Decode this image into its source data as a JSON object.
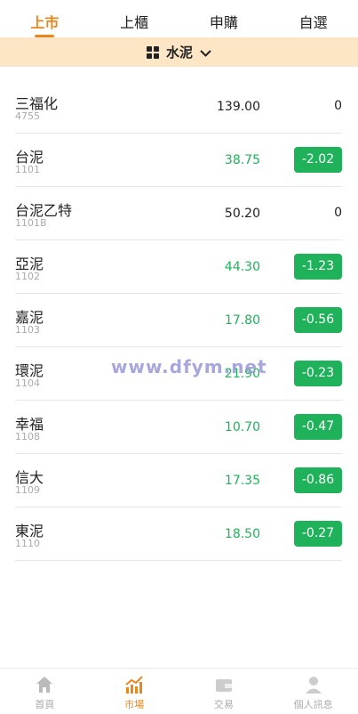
{
  "tabs": [
    {
      "label": "上市",
      "active": true
    },
    {
      "label": "上櫃",
      "active": false
    },
    {
      "label": "申購",
      "active": false
    },
    {
      "label": "自選",
      "active": false
    }
  ],
  "sector": {
    "label": "水泥",
    "icon": "grid-icon",
    "dropdown_icon": "chevron-down-icon"
  },
  "stocks": [
    {
      "name": "三福化",
      "code": "4755",
      "price": "139.00",
      "change": "0"
    },
    {
      "name": "台泥",
      "code": "1101",
      "price": "38.75",
      "change": "-2.02"
    },
    {
      "name": "台泥乙特",
      "code": "1101B",
      "price": "50.20",
      "change": "0"
    },
    {
      "name": "亞泥",
      "code": "1102",
      "price": "44.30",
      "change": "-1.23"
    },
    {
      "name": "嘉泥",
      "code": "1103",
      "price": "17.80",
      "change": "-0.56"
    },
    {
      "name": "環泥",
      "code": "1104",
      "price": "21.90",
      "change": "-0.23"
    },
    {
      "name": "幸福",
      "code": "1108",
      "price": "10.70",
      "change": "-0.47"
    },
    {
      "name": "信大",
      "code": "1109",
      "price": "17.35",
      "change": "-0.86"
    },
    {
      "name": "東泥",
      "code": "1110",
      "price": "18.50",
      "change": "-0.27"
    }
  ],
  "watermark": "www.dfym.net",
  "nav": [
    {
      "label": "首頁",
      "icon": "home-icon",
      "active": false
    },
    {
      "label": "市場",
      "icon": "chart-icon",
      "active": true
    },
    {
      "label": "交易",
      "icon": "wallet-icon",
      "active": false
    },
    {
      "label": "個人訊息",
      "icon": "person-icon",
      "active": false
    }
  ],
  "colors": {
    "accent": "#e8871e",
    "down": "#1fb25a",
    "sector_bg": "#fde6c6"
  }
}
